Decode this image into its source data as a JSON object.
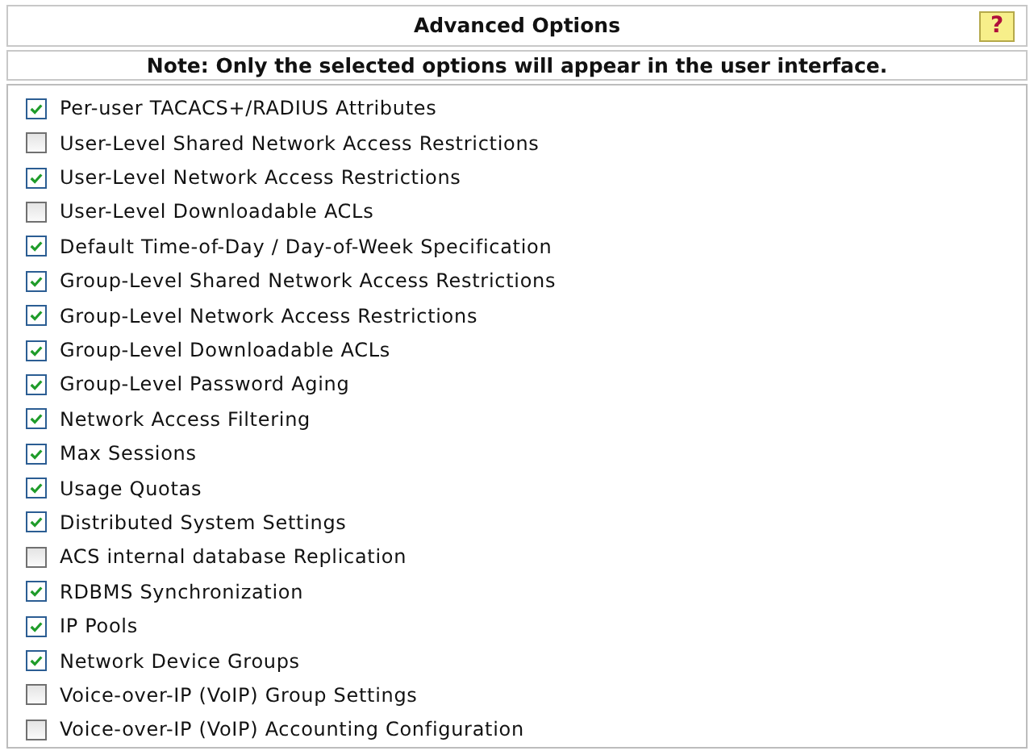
{
  "header": {
    "title": "Advanced Options",
    "help_button": "?"
  },
  "note": "Note: Only the selected options will appear in the user interface.",
  "options": [
    {
      "label": "Per-user TACACS+/RADIUS Attributes",
      "checked": true
    },
    {
      "label": "User-Level Shared Network Access Restrictions",
      "checked": false
    },
    {
      "label": "User-Level Network Access Restrictions",
      "checked": true
    },
    {
      "label": "User-Level Downloadable ACLs",
      "checked": false
    },
    {
      "label": "Default Time-of-Day / Day-of-Week Specification",
      "checked": true
    },
    {
      "label": "Group-Level Shared Network Access Restrictions",
      "checked": true
    },
    {
      "label": "Group-Level Network Access Restrictions",
      "checked": true
    },
    {
      "label": "Group-Level Downloadable ACLs",
      "checked": true
    },
    {
      "label": "Group-Level Password Aging",
      "checked": true
    },
    {
      "label": "Network Access Filtering",
      "checked": true
    },
    {
      "label": "Max Sessions",
      "checked": true
    },
    {
      "label": "Usage Quotas",
      "checked": true
    },
    {
      "label": "Distributed System Settings",
      "checked": true
    },
    {
      "label": "ACS internal database Replication",
      "checked": false
    },
    {
      "label": "RDBMS Synchronization",
      "checked": true
    },
    {
      "label": "IP Pools",
      "checked": true
    },
    {
      "label": "Network Device Groups",
      "checked": true
    },
    {
      "label": "Voice-over-IP (VoIP) Group Settings",
      "checked": false
    },
    {
      "label": "Voice-over-IP (VoIP) Accounting Configuration",
      "checked": false
    }
  ]
}
